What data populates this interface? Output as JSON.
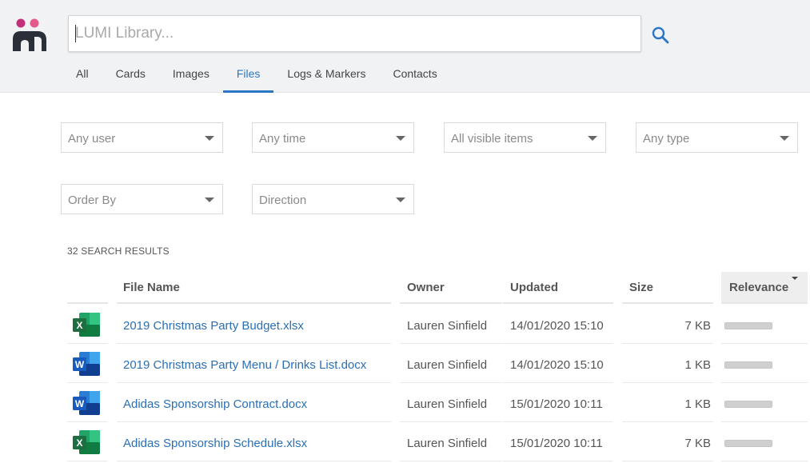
{
  "app": {
    "logo_icon": "lumi-logo-icon",
    "colors": {
      "accent": "#2a77c6",
      "logo_dot_left": "#c2307a",
      "logo_dot_right": "#e25b8c",
      "logo_body": "#2b2f3a"
    }
  },
  "search": {
    "placeholder": "LUMI Library...",
    "value": "",
    "icon": "search-icon"
  },
  "tabs": [
    {
      "label": "All",
      "active": false
    },
    {
      "label": "Cards",
      "active": false
    },
    {
      "label": "Images",
      "active": false
    },
    {
      "label": "Files",
      "active": true
    },
    {
      "label": "Logs & Markers",
      "active": false
    },
    {
      "label": "Contacts",
      "active": false
    }
  ],
  "filters": {
    "user": "Any user",
    "time": "Any time",
    "visibility": "All visible items",
    "type": "Any type",
    "order_by": "Order By",
    "direction": "Direction"
  },
  "results": {
    "count_label": "32 SEARCH RESULTS",
    "columns": {
      "name": "File Name",
      "owner": "Owner",
      "updated": "Updated",
      "size": "Size",
      "relevance": "Relevance"
    },
    "sorted_by": "Relevance",
    "rows": [
      {
        "type": "excel",
        "icon": "excel-file-icon",
        "name": "2019 Christmas Party Budget.xlsx",
        "owner": "Lauren Sinfield",
        "updated": "14/01/2020 15:10",
        "size": "7 KB",
        "relevance": 1.0
      },
      {
        "type": "word",
        "icon": "word-file-icon",
        "name": "2019 Christmas Party Menu / Drinks List.docx",
        "owner": "Lauren Sinfield",
        "updated": "14/01/2020 15:10",
        "size": "1 KB",
        "relevance": 1.0
      },
      {
        "type": "word",
        "icon": "word-file-icon",
        "name": "Adidas Sponsorship Contract.docx",
        "owner": "Lauren Sinfield",
        "updated": "15/01/2020 10:11",
        "size": "1 KB",
        "relevance": 1.0
      },
      {
        "type": "excel",
        "icon": "excel-file-icon",
        "name": "Adidas Sponsorship Schedule.xlsx",
        "owner": "Lauren Sinfield",
        "updated": "15/01/2020 10:11",
        "size": "7 KB",
        "relevance": 1.0
      }
    ]
  }
}
